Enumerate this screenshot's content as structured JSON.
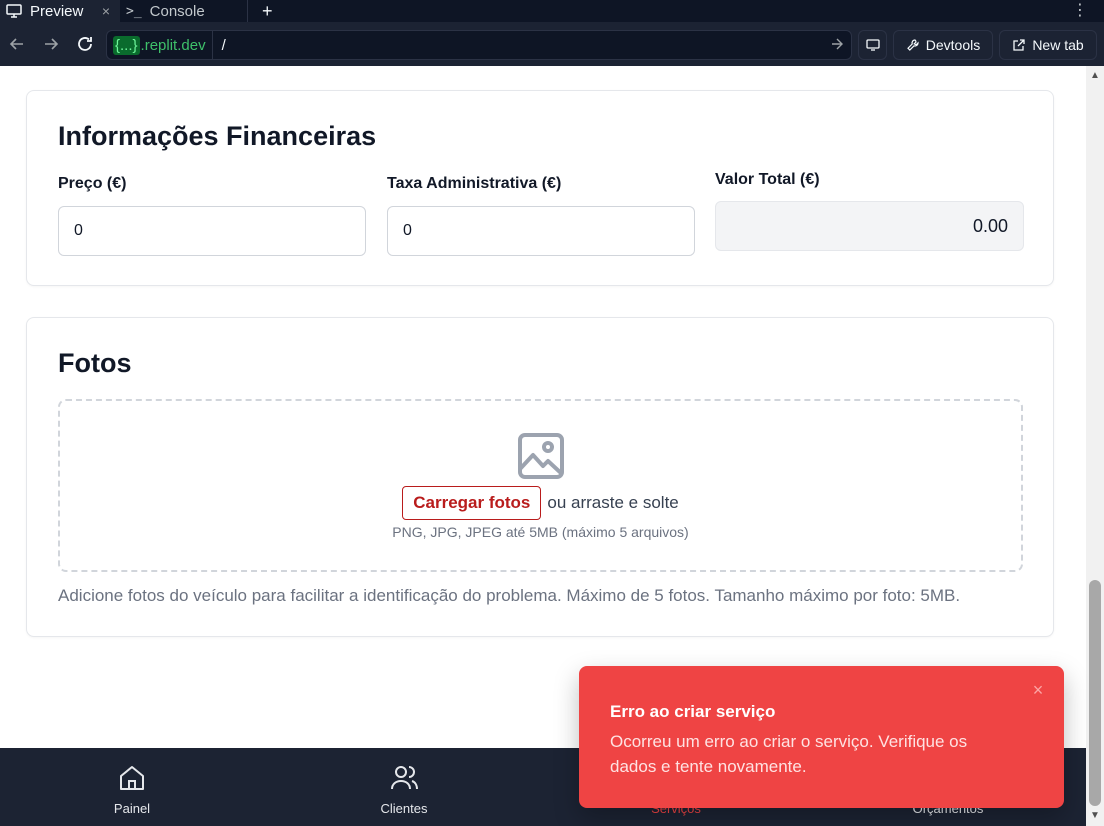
{
  "tabs": {
    "preview_label": "Preview",
    "console_label": "Console",
    "add_label": "+",
    "close_label": "×",
    "more_label": "⋮"
  },
  "browser": {
    "host_braces": "{...}",
    "host_domain": ".replit.dev",
    "path": "/",
    "devtools_label": "Devtools",
    "newtab_label": "New tab"
  },
  "financial": {
    "title": "Informações Financeiras",
    "price_label": "Preço (€)",
    "price_value": "0",
    "fee_label": "Taxa Administrativa (€)",
    "fee_value": "0",
    "total_label": "Valor Total (€)",
    "total_value": "0.00"
  },
  "photos": {
    "title": "Fotos",
    "upload_button": "Carregar fotos",
    "or_text": "ou arraste e solte",
    "hint": "PNG, JPG, JPEG até 5MB (máximo 5 arquivos)",
    "help": "Adicione fotos do veículo para facilitar a identificação do problema. Máximo de 5 fotos. Tamanho máximo por foto: 5MB."
  },
  "bottom_nav": {
    "items": [
      {
        "label": "Painel",
        "icon": "home-icon"
      },
      {
        "label": "Clientes",
        "icon": "users-icon"
      },
      {
        "label": "Serviços",
        "icon": "wrench-icon"
      },
      {
        "label": "Orçamentos",
        "icon": "file-icon"
      }
    ],
    "active_color": "#ef4444"
  },
  "toast": {
    "title": "Erro ao criar serviço",
    "description": "Ocorreu um erro ao criar o serviço. Verifique os dados e tente novamente.",
    "close": "×",
    "color": "#ef4444"
  }
}
